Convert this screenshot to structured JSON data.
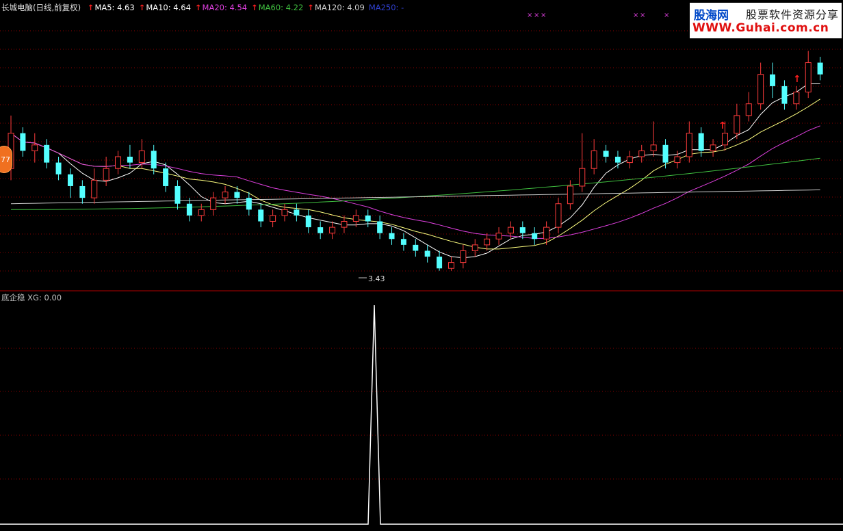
{
  "header": {
    "title": "长城电脑(日线,前复权)",
    "ma": [
      {
        "label": "MA5: 4.63",
        "color": "#ffffff",
        "arrow": "up"
      },
      {
        "label": "MA10: 4.64",
        "color": "#ffffff",
        "arrow": "up"
      },
      {
        "label": "MA20: 4.54",
        "color": "#e040e0",
        "arrow": "up"
      },
      {
        "label": "MA60: 4.22",
        "color": "#40c040",
        "arrow": "up"
      },
      {
        "label": "MA120: 4.09",
        "color": "#d0d0d0",
        "arrow": "up"
      },
      {
        "label": "MA250: -",
        "color": "#3040d0",
        "arrow": ""
      }
    ]
  },
  "indicator": {
    "label": "底企稳 XG: 0.00"
  },
  "annotations": {
    "low_label": "3.43",
    "badge": "77"
  },
  "logo": {
    "line1_a": "股海网",
    "line1_b": "股票软件资源分享",
    "line2": "WWW.Guhai.com.cn"
  },
  "colors": {
    "up": "#ff3c3c",
    "down": "#54ffff",
    "grid": "#8b0000",
    "ma5": "#ffffff",
    "ma10": "#ffff80",
    "ma20": "#e040e0",
    "ma60": "#40c040",
    "ma120": "#d0d0d0"
  },
  "chart_data": {
    "type": "candlestick",
    "low_price": 3.43,
    "candles": [
      [
        4.3,
        4.6,
        4.2,
        4.75
      ],
      [
        4.6,
        4.45,
        4.4,
        4.65
      ],
      [
        4.45,
        4.5,
        4.35,
        4.6
      ],
      [
        4.5,
        4.35,
        4.3,
        4.55
      ],
      [
        4.35,
        4.25,
        4.2,
        4.4
      ],
      [
        4.25,
        4.15,
        4.05,
        4.3
      ],
      [
        4.15,
        4.05,
        4.0,
        4.2
      ],
      [
        4.05,
        4.2,
        4.0,
        4.3
      ],
      [
        4.2,
        4.3,
        4.15,
        4.4
      ],
      [
        4.3,
        4.4,
        4.25,
        4.45
      ],
      [
        4.4,
        4.35,
        4.3,
        4.5
      ],
      [
        4.35,
        4.45,
        4.3,
        4.55
      ],
      [
        4.45,
        4.3,
        4.25,
        4.5
      ],
      [
        4.3,
        4.15,
        4.1,
        4.35
      ],
      [
        4.15,
        4.0,
        3.95,
        4.2
      ],
      [
        4.0,
        3.9,
        3.85,
        4.05
      ],
      [
        3.9,
        3.95,
        3.85,
        4.0
      ],
      [
        3.95,
        4.05,
        3.9,
        4.1
      ],
      [
        4.05,
        4.1,
        4.0,
        4.15
      ],
      [
        4.1,
        4.05,
        4.0,
        4.15
      ],
      [
        4.05,
        3.95,
        3.9,
        4.1
      ],
      [
        3.95,
        3.85,
        3.8,
        4.0
      ],
      [
        3.85,
        3.9,
        3.8,
        3.95
      ],
      [
        3.9,
        3.95,
        3.85,
        4.0
      ],
      [
        3.95,
        3.9,
        3.85,
        4.0
      ],
      [
        3.9,
        3.8,
        3.75,
        3.95
      ],
      [
        3.8,
        3.75,
        3.7,
        3.85
      ],
      [
        3.75,
        3.8,
        3.7,
        3.85
      ],
      [
        3.8,
        3.85,
        3.75,
        3.9
      ],
      [
        3.85,
        3.9,
        3.8,
        3.95
      ],
      [
        3.9,
        3.85,
        3.8,
        3.95
      ],
      [
        3.85,
        3.75,
        3.7,
        3.9
      ],
      [
        3.75,
        3.7,
        3.65,
        3.8
      ],
      [
        3.7,
        3.65,
        3.6,
        3.75
      ],
      [
        3.65,
        3.6,
        3.55,
        3.7
      ],
      [
        3.6,
        3.55,
        3.5,
        3.65
      ],
      [
        3.55,
        3.45,
        3.43,
        3.6
      ],
      [
        3.45,
        3.5,
        3.43,
        3.55
      ],
      [
        3.5,
        3.6,
        3.45,
        3.65
      ],
      [
        3.6,
        3.65,
        3.55,
        3.7
      ],
      [
        3.65,
        3.7,
        3.6,
        3.75
      ],
      [
        3.7,
        3.75,
        3.65,
        3.8
      ],
      [
        3.75,
        3.8,
        3.7,
        3.85
      ],
      [
        3.8,
        3.75,
        3.7,
        3.85
      ],
      [
        3.75,
        3.7,
        3.65,
        3.8
      ],
      [
        3.7,
        3.8,
        3.65,
        3.85
      ],
      [
        3.8,
        4.0,
        3.75,
        4.05
      ],
      [
        4.0,
        4.15,
        3.95,
        4.2
      ],
      [
        4.15,
        4.3,
        4.1,
        4.6
      ],
      [
        4.3,
        4.45,
        4.25,
        4.55
      ],
      [
        4.45,
        4.4,
        4.35,
        4.5
      ],
      [
        4.4,
        4.35,
        4.3,
        4.45
      ],
      [
        4.35,
        4.4,
        4.3,
        4.45
      ],
      [
        4.4,
        4.45,
        4.35,
        4.5
      ],
      [
        4.45,
        4.5,
        4.4,
        4.7
      ],
      [
        4.5,
        4.35,
        4.3,
        4.55
      ],
      [
        4.35,
        4.4,
        4.3,
        4.45
      ],
      [
        4.4,
        4.6,
        4.35,
        4.7
      ],
      [
        4.6,
        4.45,
        4.4,
        4.65
      ],
      [
        4.45,
        4.5,
        4.4,
        4.55
      ],
      [
        4.5,
        4.6,
        4.45,
        4.7
      ],
      [
        4.6,
        4.75,
        4.55,
        4.85
      ],
      [
        4.75,
        4.85,
        4.7,
        4.95
      ],
      [
        4.85,
        5.1,
        4.8,
        5.2
      ],
      [
        5.1,
        5.0,
        4.9,
        5.2
      ],
      [
        5.0,
        4.85,
        4.8,
        5.05
      ],
      [
        4.85,
        4.95,
        4.8,
        5.0
      ],
      [
        4.95,
        5.2,
        4.9,
        5.3
      ],
      [
        5.2,
        5.1,
        5.05,
        5.25
      ]
    ]
  }
}
